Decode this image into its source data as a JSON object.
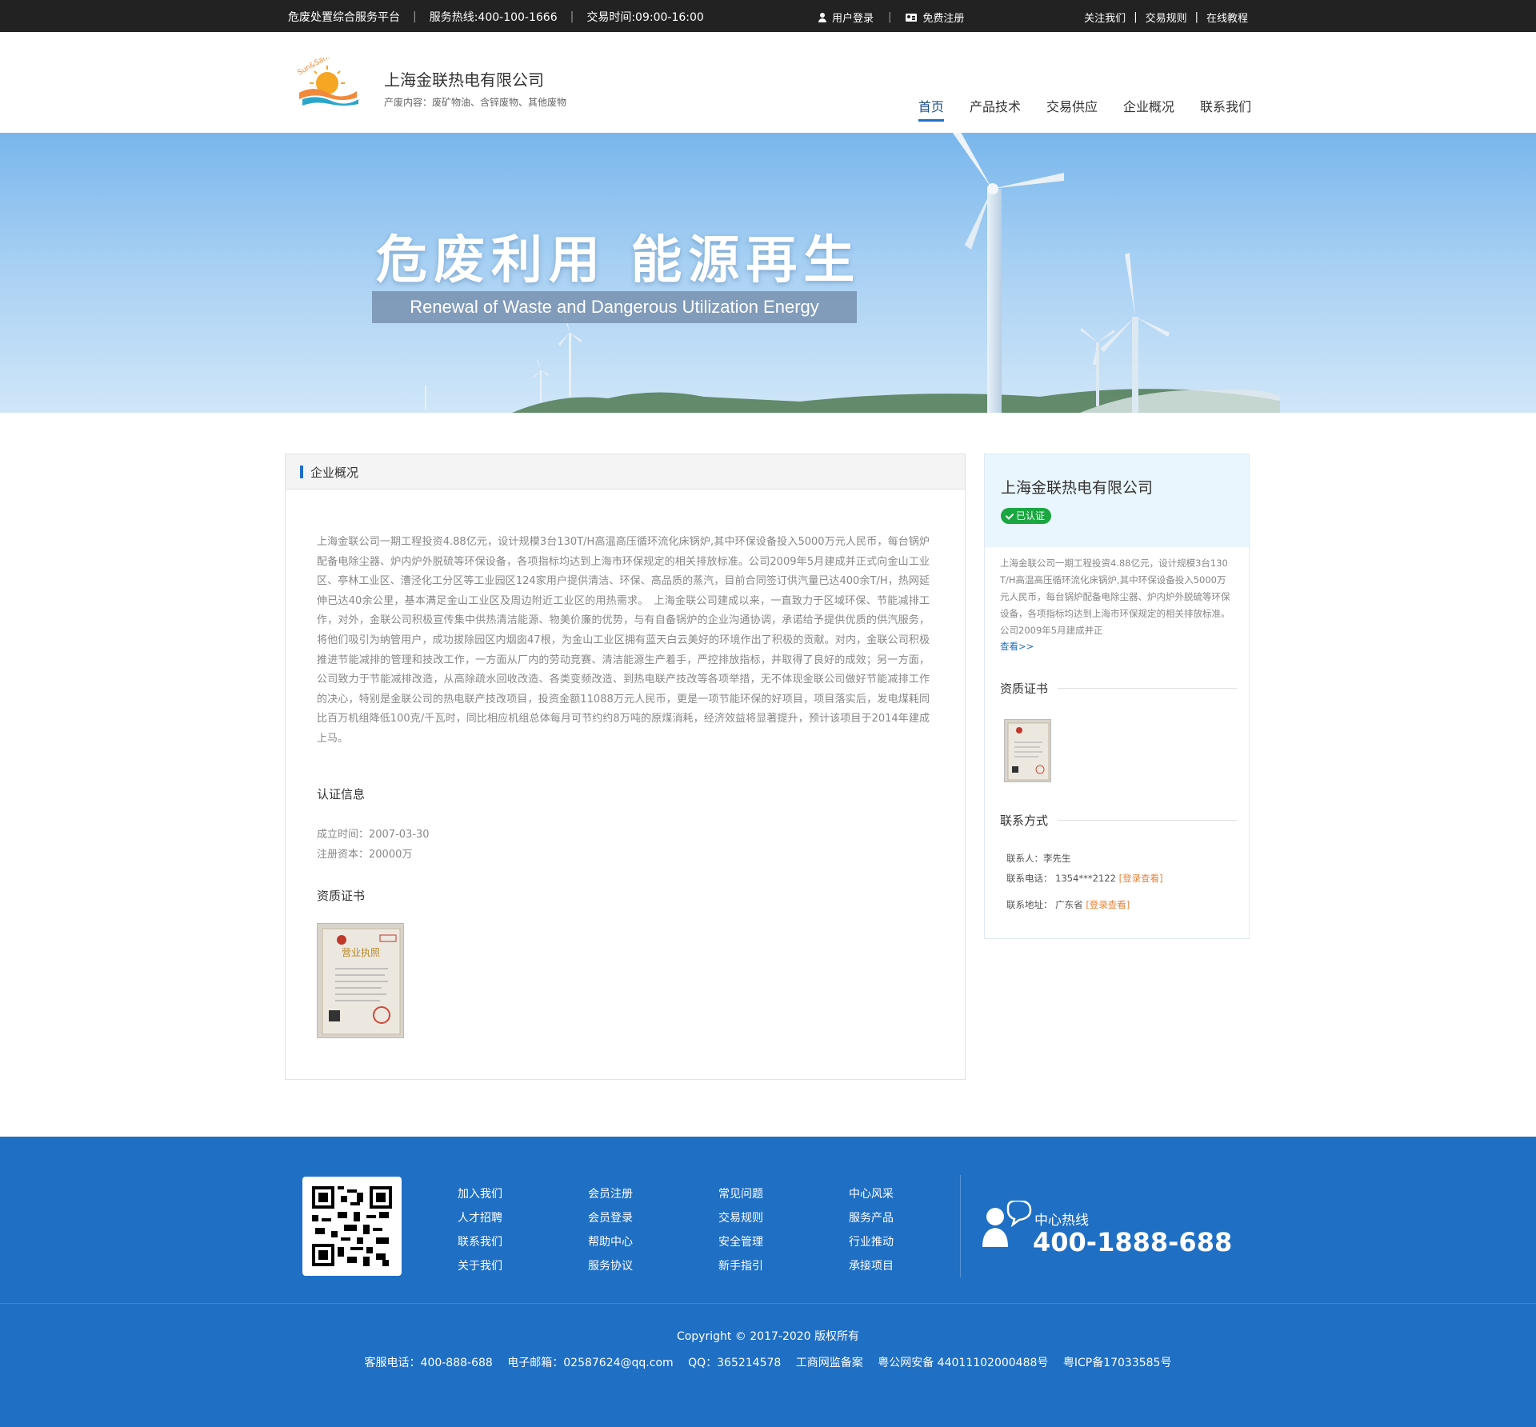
{
  "topbar": {
    "platform": "危废处置综合服务平台",
    "hotline": "服务热线:400-100-1666",
    "hours": "交易时间:09:00-16:00",
    "login": "用户登录",
    "register": "免费注册",
    "follow": "关注我们",
    "rules": "交易规则",
    "tutorial": "在线教程"
  },
  "header": {
    "company_name": "上海金联热电有限公司",
    "company_sub": "产废内容：废矿物油、含锌废物、其他废物",
    "logo_text": "Sun&Sand",
    "nav": [
      "首页",
      "产品技术",
      "交易供应",
      "企业概况",
      "联系我们"
    ]
  },
  "banner": {
    "title": "危废利用  能源再生",
    "subtitle": "Renewal of Waste and Dangerous Utilization Energy"
  },
  "main": {
    "title": "企业概况",
    "description": "上海金联公司一期工程投资4.88亿元，设计规模3台130T/H高温高压循环流化床锅炉,其中环保设备投入5000万元人民币，每台锅炉配备电除尘器、炉内炉外脱硫等环保设备，各项指标均达到上海市环保规定的相关排放标准。公司2009年5月建成并正式向金山工业区、亭林工业区、漕泾化工分区等工业园区124家用户提供清洁、环保、高品质的蒸汽，目前合同签订供汽量已达400余T/H，热网延伸已达40余公里，基本满足金山工业区及周边附近工业区的用热需求。　上海金联公司建成以来，一直致力于区域环保、节能减排工作，对外，金联公司积极宣传集中供热清洁能源、物美价廉的优势，与有自备锅炉的企业沟通协调，承诺给予提供优质的供汽服务，将他们吸引为纳管用户，成功拔除园区内烟囱47根，为金山工业区拥有蓝天白云美好的环境作出了积极的贡献。对内，金联公司积极推进节能减排的管理和技改工作，一方面从厂内的劳动竞赛、清洁能源生产着手，严控排放指标，并取得了良好的成效；另一方面，公司致力于节能减排改造，从高除疏水回收改造、各类变频改造、到热电联产技改等各项举措，无不体现金联公司做好节能减排工作的决心，特别是金联公司的热电联产技改项目，投资金额11088万元人民币，更是一项节能环保的好项目，项目落实后，发电煤耗同比百万机组降低100克/千瓦时，同比相应机组总体每月可节约约8万吨的原煤消耗，经济效益将显著提升，预计该项目于2014年建成上马。",
    "cert_title": "认证信息",
    "established": "成立时间：2007-03-30",
    "capital": "注册资本：20000万",
    "qual_title": "资质证书",
    "cert_text": "营业执照"
  },
  "side": {
    "name": "上海金联热电有限公司",
    "badge": "已认证",
    "description": "上海金联公司一期工程投资4.88亿元，设计规模3台130T/H高温高压循环流化床锅炉,其中环保设备投入5000万元人民币，每台锅炉配备电除尘器、炉内炉外脱硫等环保设备，各项指标均达到上海市环保规定的相关排放标准。公司2009年5月建成并正",
    "more": "查看>>",
    "qual_title": "资质证书",
    "contact_title": "联系方式",
    "contact_person": "联系人：李先生",
    "contact_phone": "联系电话： 1354***2122 ",
    "contact_address": "联系地址： 广东省 ",
    "login_view": "[登录查看]"
  },
  "footer": {
    "links": [
      [
        "加入我们",
        "人才招聘",
        "联系我们",
        "关于我们"
      ],
      [
        "会员注册",
        "会员登录",
        "帮助中心",
        "服务协议"
      ],
      [
        "常见问题",
        "交易规则",
        "安全管理",
        "新手指引"
      ],
      [
        "中心风采",
        "服务产品",
        "行业推动",
        "承接项目"
      ]
    ],
    "hotline_label": "中心热线",
    "hotline_number": "400-1888-688",
    "copyright": "Copyright © 2017-2020  版权所有",
    "service_phone": "客服电话：400-888-688",
    "email": "电子邮箱：02587624@qq.com",
    "qq": "QQ：365214578",
    "supervision": "工商网监备案",
    "police": "粤公网安备 44011102000488号",
    "icp": "粤ICP备17033585号"
  },
  "colors": {
    "accent": "#1e6fc7",
    "footer_bg": "#1f6fc5",
    "topbar_bg": "#222222",
    "badge": "#1aa640",
    "link_orange": "#e8843b"
  }
}
